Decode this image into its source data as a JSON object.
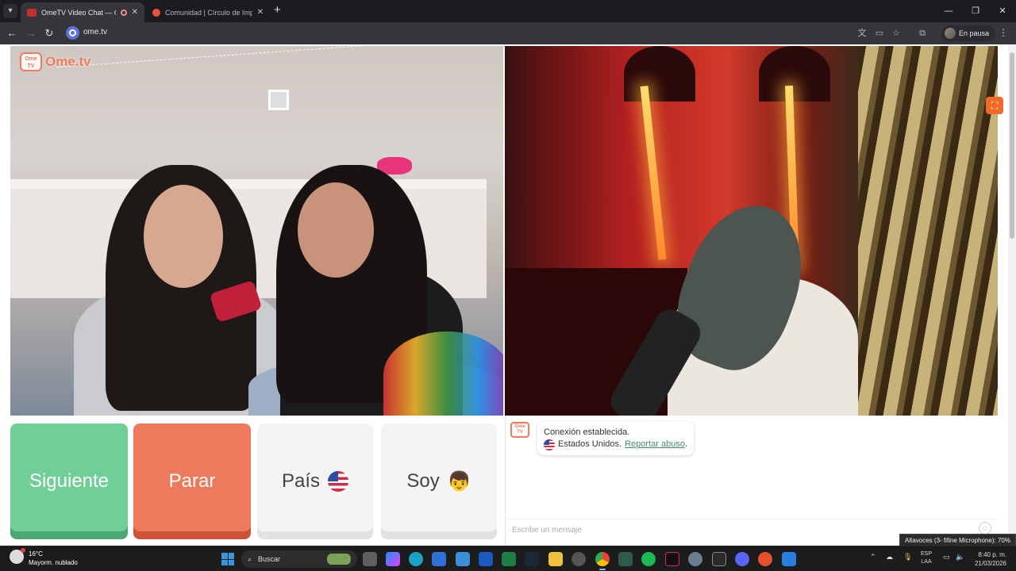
{
  "browser": {
    "tabs": [
      {
        "title": "OmeTV Video Chat — Ome",
        "active": true
      },
      {
        "title": "Comunidad | Círculo de Import",
        "active": false
      }
    ],
    "url": "ome.tv",
    "profile_label": "En pausa"
  },
  "page": {
    "logo_text": "Ome.tv",
    "logo_small": "Ome TV",
    "buttons": {
      "next": "Siguiente",
      "stop": "Parar",
      "country": "País",
      "soy": "Soy"
    },
    "chat": {
      "avatar_text": "Ome TV",
      "status": "Conexión establecida.",
      "country": "Estados Unidos.",
      "report_link": "Reportar abuso",
      "period": ".",
      "input_placeholder": "Escribe un mensaje"
    },
    "volume_tooltip": "Altavoces (3- fifine Microphone): 70%"
  },
  "taskbar": {
    "weather_temp": "16°C",
    "weather_desc": "Mayorm. nublado",
    "search_label": "Buscar",
    "lang_top": "ESP",
    "lang_bottom": "LAA",
    "time": "8:40 p. m.",
    "date": "21/03/2026"
  },
  "colors": {
    "next": "#6fcf97",
    "stop": "#ee7a5e",
    "brand": "#f07b5a",
    "report_link": "#3f8f70"
  }
}
